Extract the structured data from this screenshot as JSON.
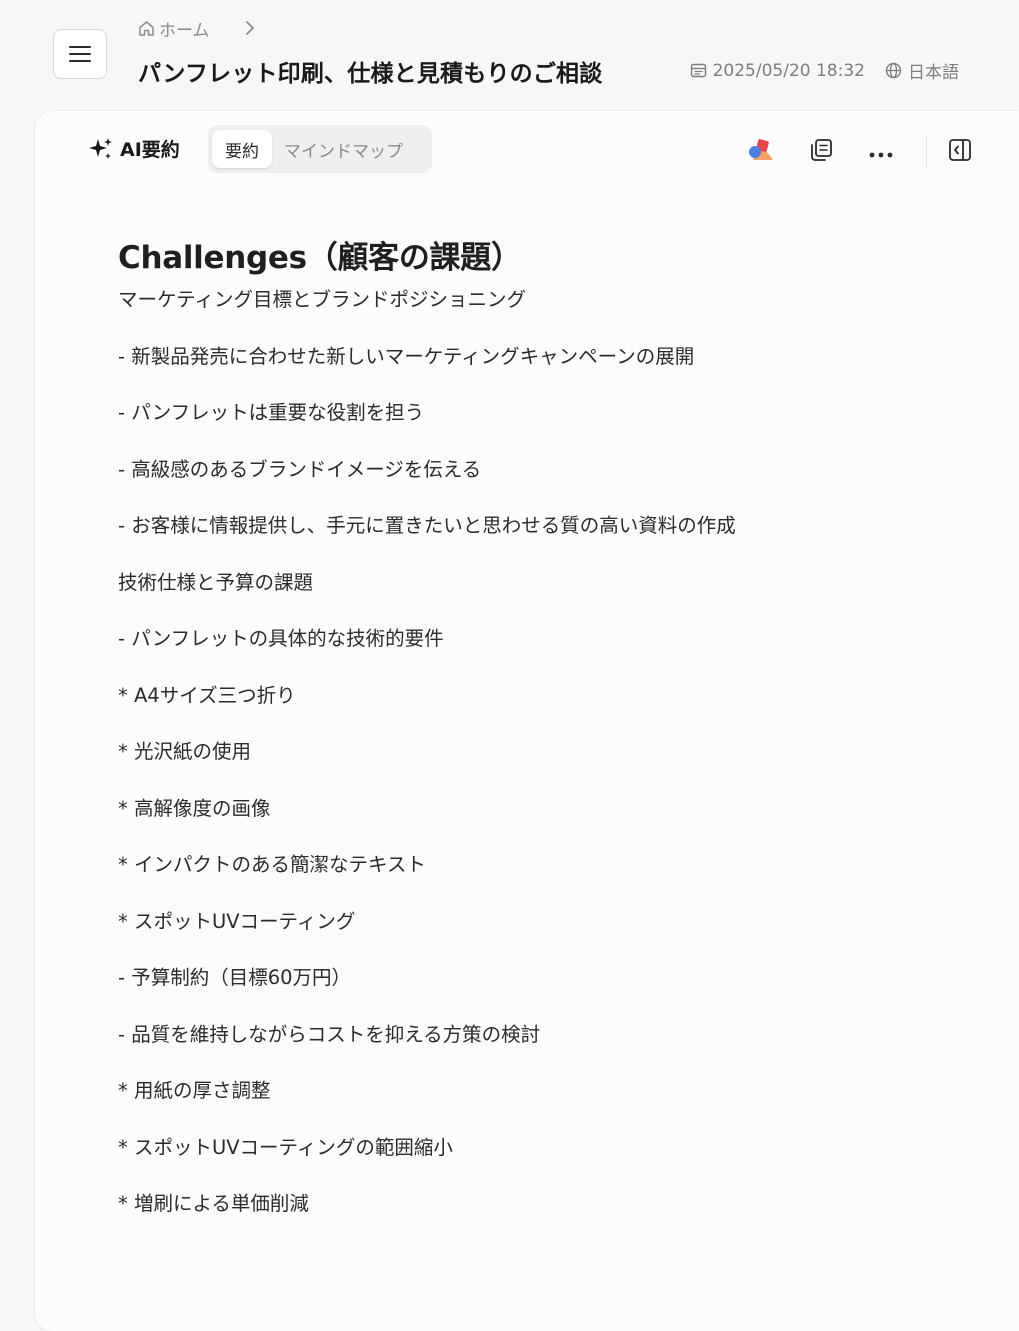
{
  "header": {
    "menu_icon": "hamburger-menu-icon",
    "breadcrumb": {
      "home_icon": "home-icon",
      "home_label": "ホーム",
      "separator_icon": "chevron-right-icon"
    },
    "title": "パンフレット印刷、仕様と見積もりのご相談",
    "datetime": "2025/05/20 18:32",
    "language": "日本語"
  },
  "toolbar": {
    "ai_icon": "sparkle-icon",
    "ai_label": "AI要約",
    "tabs": [
      {
        "label": "要約",
        "active": true
      },
      {
        "label": "マインドマップ",
        "active": false
      }
    ],
    "icons": [
      "shapes-icon",
      "copy-icon",
      "more-icon",
      "side-panel-icon"
    ]
  },
  "summary": {
    "heading": "Challenges（顧客の課題）",
    "lines": [
      "マーケティング目標とブランドポジショニング",
      "- 新製品発売に合わせた新しいマーケティングキャンペーンの展開",
      "- パンフレットは重要な役割を担う",
      "- 高級感のあるブランドイメージを伝える",
      "- お客様に情報提供し、手元に置きたいと思わせる質の高い資料の作成",
      "技術仕様と予算の課題",
      "- パンフレットの具体的な技術的要件",
      "* A4サイズ三つ折り",
      "* 光沢紙の使用",
      "* 高解像度の画像",
      "* インパクトのある簡潔なテキスト",
      "* スポットUVコーティング",
      "- 予算制約（目標60万円）",
      "- 品質を維持しながらコストを抑える方策の検討",
      "* 用紙の厚さ調整",
      "* スポットUVコーティングの範囲縮小",
      "* 増刷による単価削減"
    ]
  },
  "colors": {
    "background": "#f7f7f8",
    "card": "#fcfcfd",
    "text": "#1f1f1f",
    "muted": "#8a8a8e"
  }
}
